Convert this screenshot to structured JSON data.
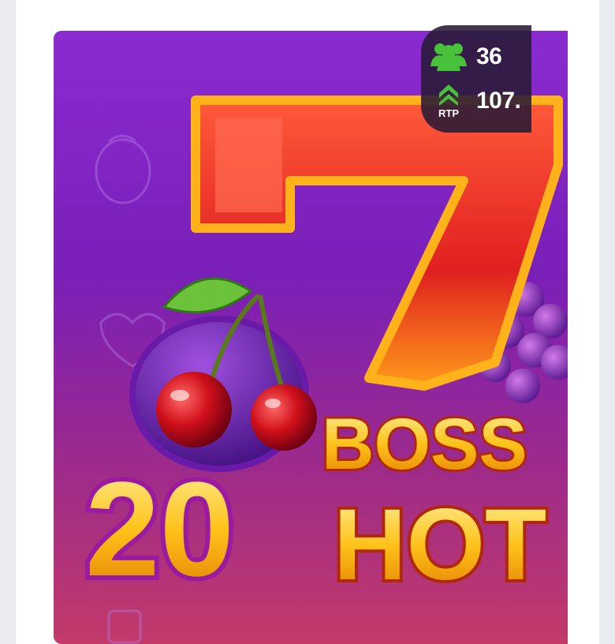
{
  "game": {
    "title_line1": "BOSS",
    "title_number": "20",
    "title_line2": "HOT",
    "players_icon": "users-icon",
    "rtp_icon": "chevrons-up-icon",
    "players_count": "36",
    "rtp_label": "RTP",
    "rtp_value": "107.",
    "accent_color": "#47c23a",
    "panel_color": "#281a36"
  }
}
